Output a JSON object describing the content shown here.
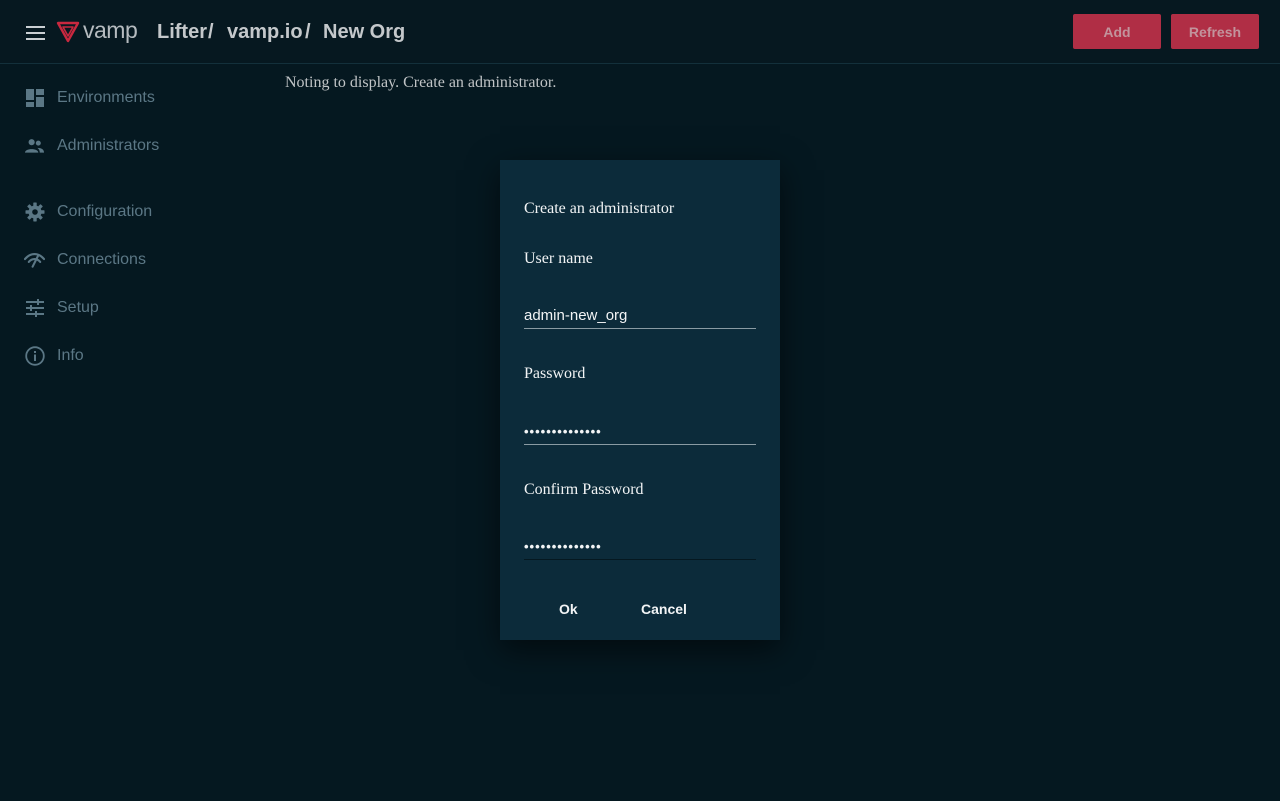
{
  "header": {
    "logo_text": "vamp",
    "breadcrumb": [
      "Lifter",
      "vamp.io",
      "New Org"
    ],
    "separator": "/",
    "add_label": "Add",
    "refresh_label": "Refresh",
    "accent_color": "#b02e45"
  },
  "sidebar": {
    "items": [
      {
        "label": "Environments",
        "icon": "dashboard-icon"
      },
      {
        "label": "Administrators",
        "icon": "people-icon"
      },
      {
        "label": "Configuration",
        "icon": "gear-icon"
      },
      {
        "label": "Connections",
        "icon": "signal-icon"
      },
      {
        "label": "Setup",
        "icon": "sliders-icon"
      },
      {
        "label": "Info",
        "icon": "info-icon"
      }
    ]
  },
  "main": {
    "empty_message": "Noting to display. Create an administrator."
  },
  "dialog": {
    "title": "Create an administrator",
    "username_label": "User name",
    "username_value": "admin-new_org",
    "password_label": "Password",
    "password_value": "••••••••••••••",
    "confirm_label": "Confirm Password",
    "confirm_value": "••••••••••••••",
    "ok_label": "Ok",
    "cancel_label": "Cancel"
  }
}
